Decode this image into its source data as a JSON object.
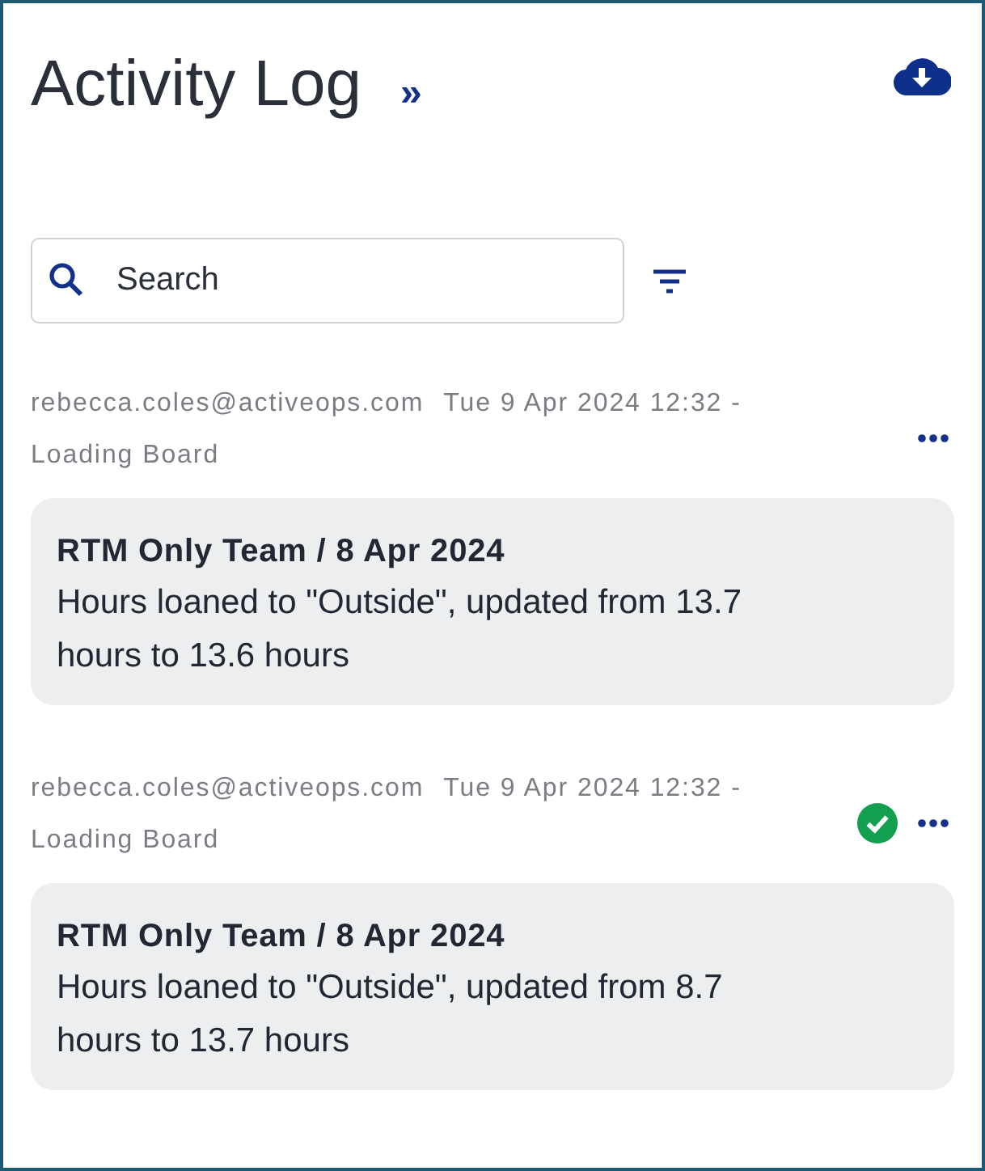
{
  "header": {
    "title": "Activity Log",
    "collapse": "»"
  },
  "search": {
    "placeholder": "Search"
  },
  "entries": [
    {
      "user": "rebecca.coles@activeops.com",
      "detail": "Tue 9 Apr 2024 12:32 - Loading Board",
      "verified": false,
      "heading": "RTM Only Team / 8 Apr 2024",
      "message": "Hours loaned to \"Outside\", updated from 13.7 hours to 13.6 hours"
    },
    {
      "user": "rebecca.coles@activeops.com",
      "detail": "Tue 9 Apr 2024 12:32 - Loading Board",
      "verified": true,
      "heading": "RTM Only Team / 8 Apr 2024",
      "message": "Hours loaned to \"Outside\", updated from 8.7 hours to 13.7 hours"
    }
  ]
}
